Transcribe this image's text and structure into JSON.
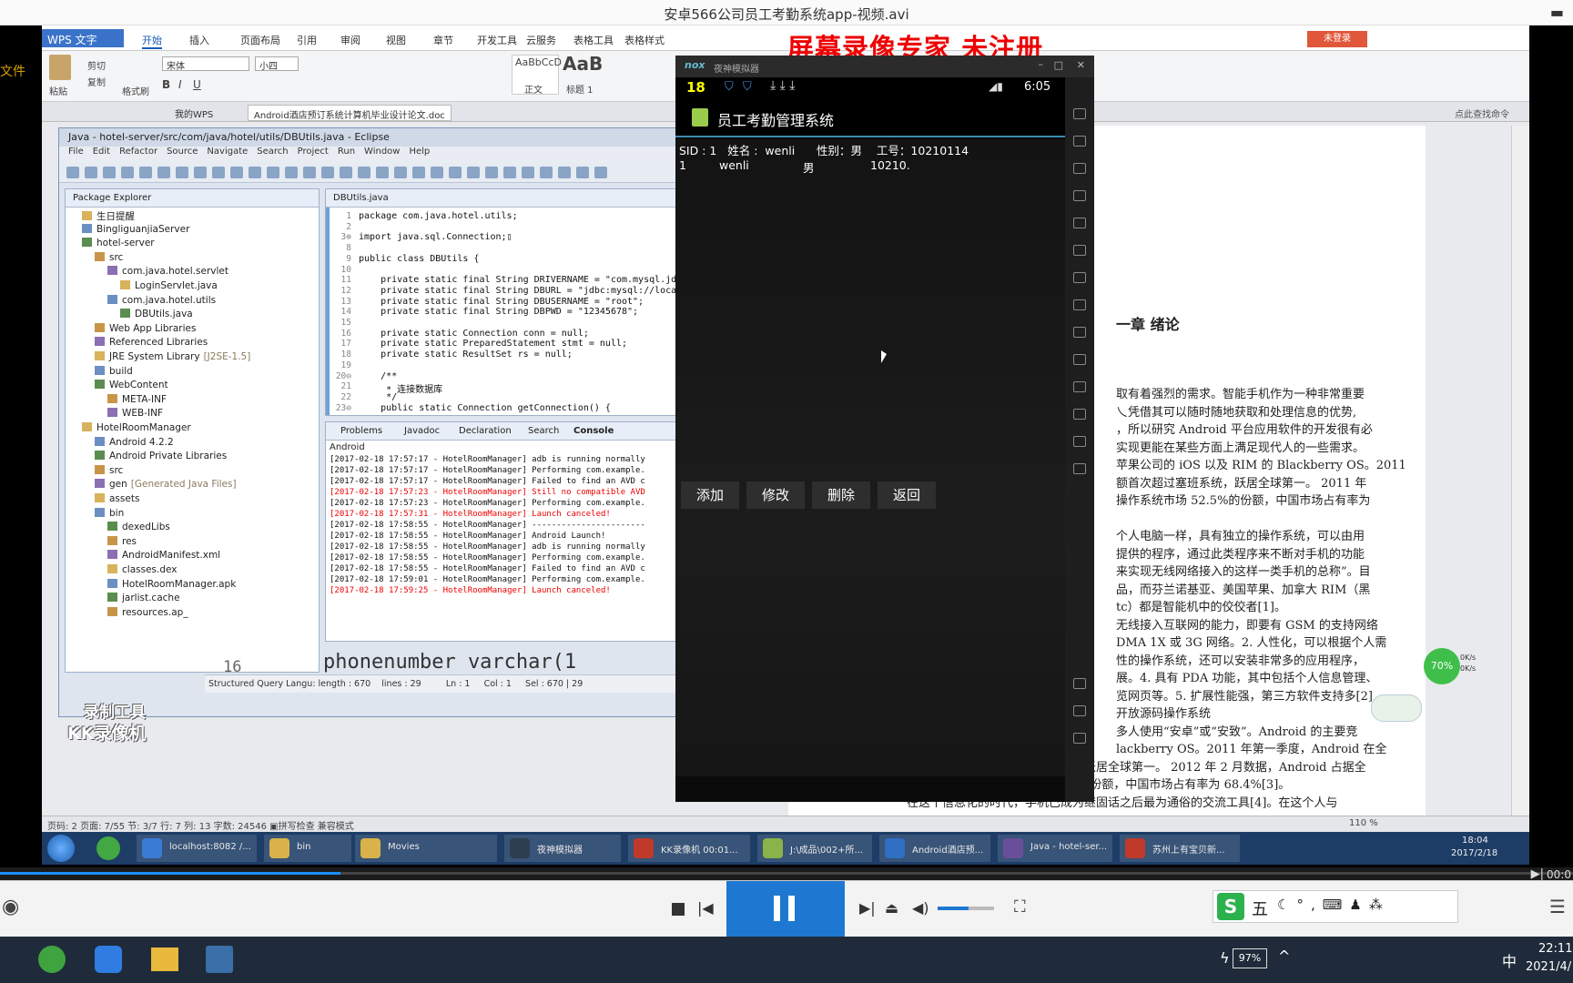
{
  "player": {
    "title": "安卓566公司员工考勤系统app-视频.avi",
    "time_right": "00:0"
  },
  "watermark": "屏幕录像专家  未注册",
  "wps": {
    "brand": "WPS 文字",
    "tabs": [
      "开始",
      "插入",
      "页面布局",
      "引用",
      "审阅",
      "视图",
      "章节",
      "开发工具",
      "云服务",
      "表格工具",
      "表格样式"
    ],
    "login": "未登录",
    "font_name": "宋体",
    "font_size": "小四",
    "style_normal": "正文",
    "style_h1": "标题 1",
    "style_sample": "AaBbCcD",
    "style_big": "AaB",
    "paste": "粘贴",
    "cut": "剪切",
    "copy": "复制",
    "format_painter": "格式刷",
    "doctab1": "我的WPS",
    "doctab2": "Android酒店预订系统计算机毕业设计论文.doc",
    "search_tip": "点此查找命令",
    "left_label": "文件",
    "chapter_heading": "一章  绪论",
    "paragraphs": [
      "取有着强烈的需求。智能手机作为一种非常重要",
      "乀凭借其可以随时随地获取和处理信息的优势,",
      "，所以研究 Android 平台应用软件的开发很有必",
      "实现更能在某些方面上满足现代人的一些需求。",
      "苹果公司的 iOS 以及 RIM 的 Blackberry OS。2011",
      "额首次超过塞班系统，跃居全球第一。 2011 年",
      "操作系统市场 52.5%的份额，中国市场占有率为",
      "",
      "个人电脑一样，具有独立的操作系统，可以由用",
      "提供的程序，通过此类程序来不断对手机的功能",
      "来实现无线网络接入的这样一类手机的总称”。目",
      "品，而芬兰诺基亚、美国苹果、加拿大 RIM（黑",
      "tc）都是智能机中的佼佼者[1]。",
      "无线接入互联网的能力，即要有 GSM 的支持网络",
      "DMA 1X 或 3G 网络。2. 人性化，可以根据个人需",
      "性的操作系统，还可以安装非常多的应用程序，",
      "展。4. 具有 PDA 功能，其中包括个人信息管理、",
      "览网页等。5. 扩展性能强，第三方软件支持多[2]",
      "开放源码操作系统",
      "多人使用“安卓”或“安致”。Android 的主要竞",
      "lackberry OS。2011 年第一季度，Android 在全",
      "球的市场份额首次超过塞班系统，跃居全球第一。 2012 年 2 月数据，Android 占据全",
      "球智能手机操作系统市场 52.5%的份额，中国市场占有率为 68.4%[3]。",
      "在这个信息化的时代，手机已成为继固话之后最为通俗的交流工具[4]。在这个人与"
    ],
    "status": "页码: 2   页面: 7/55   节: 3/7   行: 7   列: 13   字数: 24546   ▣拼写检查   兼容模式",
    "zoom": "110 %",
    "speed_pct": "70%",
    "speed_up": "0K/s",
    "speed_down": "0K/s"
  },
  "eclipse": {
    "title": "Java - hotel-server/src/com/java/hotel/utils/DBUtils.java - Eclipse",
    "menu": [
      "File",
      "Edit",
      "Refactor",
      "Source",
      "Navigate",
      "Search",
      "Project",
      "Run",
      "Window",
      "Help"
    ],
    "pkg_tab": "Package Explorer",
    "editor_tab": "DBUtils.java",
    "tree": [
      {
        "label": "生日提醒",
        "indent": 1
      },
      {
        "label": "BingliguanjiaServer",
        "indent": 1
      },
      {
        "label": "hotel-server",
        "indent": 1
      },
      {
        "label": "src",
        "indent": 2
      },
      {
        "label": "com.java.hotel.servlet",
        "indent": 3
      },
      {
        "label": "LoginServlet.java",
        "indent": 4
      },
      {
        "label": "com.java.hotel.utils",
        "indent": 3
      },
      {
        "label": "DBUtils.java",
        "indent": 4
      },
      {
        "label": "Web App Libraries",
        "indent": 2
      },
      {
        "label": "Referenced Libraries",
        "indent": 2
      },
      {
        "label": "JRE System Library",
        "suffix": "[J2SE-1.5]",
        "indent": 2
      },
      {
        "label": "build",
        "indent": 2
      },
      {
        "label": "WebContent",
        "indent": 2
      },
      {
        "label": "META-INF",
        "indent": 3
      },
      {
        "label": "WEB-INF",
        "indent": 3
      },
      {
        "label": "HotelRoomManager",
        "indent": 1
      },
      {
        "label": "Android 4.2.2",
        "indent": 2
      },
      {
        "label": "Android Private Libraries",
        "indent": 2
      },
      {
        "label": "src",
        "indent": 2
      },
      {
        "label": "gen",
        "suffix": "[Generated Java Files]",
        "indent": 2
      },
      {
        "label": "assets",
        "indent": 2
      },
      {
        "label": "bin",
        "indent": 2
      },
      {
        "label": "dexedLibs",
        "indent": 3
      },
      {
        "label": "res",
        "indent": 3
      },
      {
        "label": "AndroidManifest.xml",
        "indent": 3
      },
      {
        "label": "classes.dex",
        "indent": 3
      },
      {
        "label": "HotelRoomManager.apk",
        "indent": 3
      },
      {
        "label": "jarlist.cache",
        "indent": 3
      },
      {
        "label": "resources.ap_",
        "indent": 3
      }
    ],
    "code_lines": [
      {
        "n": "1",
        "t": "package com.java.hotel.utils;"
      },
      {
        "n": "2",
        "t": ""
      },
      {
        "n": "3⊕",
        "t": "import java.sql.Connection;▯"
      },
      {
        "n": "8",
        "t": ""
      },
      {
        "n": "9",
        "t": "public class DBUtils {"
      },
      {
        "n": "10",
        "t": ""
      },
      {
        "n": "11",
        "t": "    private static final String DRIVERNAME = \"com.mysql.jd"
      },
      {
        "n": "12",
        "t": "    private static final String DBURL = \"jdbc:mysql://loca"
      },
      {
        "n": "13",
        "t": "    private static final String DBUSERNAME = \"root\";"
      },
      {
        "n": "14",
        "t": "    private static final String DBPWD = \"12345678\";"
      },
      {
        "n": "15",
        "t": ""
      },
      {
        "n": "16",
        "t": "    private static Connection conn = null;"
      },
      {
        "n": "17",
        "t": "    private static PreparedStatement stmt = null;"
      },
      {
        "n": "18",
        "t": "    private static ResultSet rs = null;"
      },
      {
        "n": "19",
        "t": ""
      },
      {
        "n": "20⊖",
        "t": "    /**"
      },
      {
        "n": "21",
        "t": "     * 连接数据库"
      },
      {
        "n": "22",
        "t": "     */"
      },
      {
        "n": "23⊖",
        "t": "    public static Connection getConnection() {"
      }
    ],
    "console_tabs": [
      "Problems",
      "Javadoc",
      "Declaration",
      "Search",
      "Console"
    ],
    "console_label": "Android",
    "log": [
      {
        "t": "[2017-02-18 17:57:17 - HotelRoomManager] adb is running normally",
        "err": false
      },
      {
        "t": "[2017-02-18 17:57:17 - HotelRoomManager] Performing com.example.",
        "err": false
      },
      {
        "t": "[2017-02-18 17:57:17 - HotelRoomManager] Failed to find an AVD c",
        "err": false
      },
      {
        "t": "[2017-02-18 17:57:23 - HotelRoomManager] Still no compatible AVD",
        "err": true
      },
      {
        "t": "[2017-02-18 17:57:23 - HotelRoomManager] Performing com.example.",
        "err": false
      },
      {
        "t": "[2017-02-18 17:57:31 - HotelRoomManager] Launch canceled!",
        "err": true
      },
      {
        "t": "[2017-02-18 17:58:55 - HotelRoomManager] -----------------------",
        "err": false
      },
      {
        "t": "[2017-02-18 17:58:55 - HotelRoomManager] Android Launch!",
        "err": false
      },
      {
        "t": "[2017-02-18 17:58:55 - HotelRoomManager] adb is running normally",
        "err": false
      },
      {
        "t": "[2017-02-18 17:58:55 - HotelRoomManager] Performing com.example.",
        "err": false
      },
      {
        "t": "[2017-02-18 17:58:55 - HotelRoomManager] Failed to find an AVD c",
        "err": false
      },
      {
        "t": "[2017-02-18 17:59:01 - HotelRoomManager] Performing com.example.",
        "err": false
      },
      {
        "t": "[2017-02-18 17:59:25 - HotelRoomManager] Launch canceled!",
        "err": true
      }
    ],
    "status_text": "Structured Query Langu: length : 670    lines : 29         Ln : 1     Col : 1     Sel : 670 | 29",
    "bg_code": "phonenumber varchar(1",
    "bg_line": "16"
  },
  "kk_watermark": [
    "录制工具",
    "KK录像机"
  ],
  "emulator": {
    "brand": "nox",
    "title": "夜神模拟器",
    "clock": "6:05",
    "app_title": "员工考勤管理系统",
    "info_line": "SID : 1   姓名 :  wenli      性别：男    工号：10210114",
    "row": [
      "1",
      "wenli",
      "男",
      "10210."
    ],
    "buttons": [
      "添加",
      "修改",
      "删除",
      "返回"
    ],
    "notif": "18"
  },
  "taskbar": {
    "items": [
      {
        "label": "localhost:8082 /...",
        "color": "#3a7bd5"
      },
      {
        "label": "bin",
        "color": "#d9b24a"
      },
      {
        "label": "Movies",
        "color": "#d9b24a"
      },
      {
        "label": "夜神模拟器",
        "color": "#2c3e50"
      },
      {
        "label": "KK录像机 00:01...",
        "color": "#c0392b"
      },
      {
        "label": "J:\\成品\\002+所...",
        "color": "#8ab34a"
      },
      {
        "label": "Android酒店预...",
        "color": "#2f6fc4"
      },
      {
        "label": "Java - hotel-ser...",
        "color": "#6b4e9b"
      },
      {
        "label": "苏州上有宝贝新...",
        "color": "#c0392b"
      }
    ],
    "clock_time": "18:04",
    "clock_date": "2017/2/18"
  },
  "win": {
    "battery": "97%",
    "ime": "中",
    "time": "22:11",
    "date": "2021/4/"
  },
  "ime_bar": [
    "五"
  ]
}
